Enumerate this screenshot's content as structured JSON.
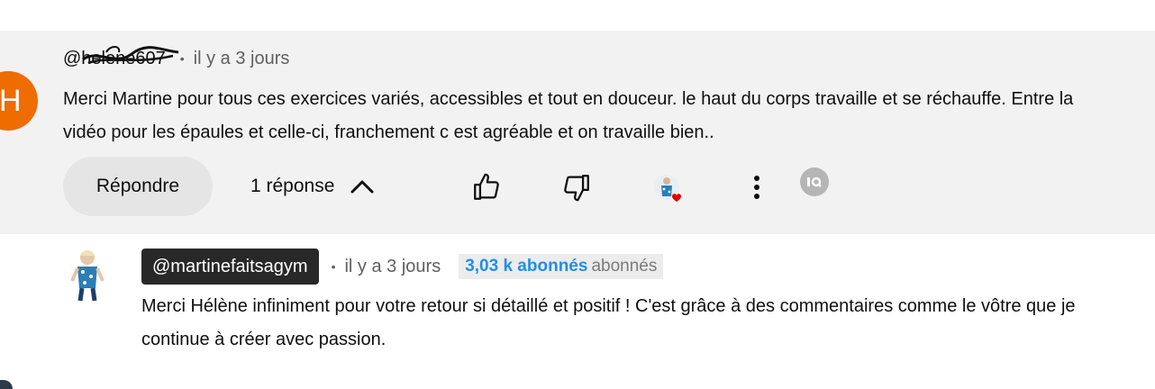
{
  "comment": {
    "avatar_letter": "H",
    "author": "@helene607",
    "separator": "•",
    "time": "il y a 3 jours",
    "text": "Merci Martine pour tous ces exercices variés, accessibles et tout en douceur. le haut du corps travaille et se réchauffe. Entre la vidéo pour les épaules et celle-ci, franchement c est agréable et on travaille bien..",
    "actions": {
      "reply_label": "Répondre",
      "replies_label": "1 réponse",
      "like_icon": "thumb-up-icon",
      "dislike_icon": "thumb-down-icon",
      "creator_heart_icon": "creator-heart-icon",
      "more_icon": "more-vert-icon"
    }
  },
  "reply": {
    "author": "@martinefaitsagym",
    "separator": "•",
    "time": "il y a 3 jours",
    "subscribers_highlight": "3,03 k abonnés",
    "subscribers_suffix": "abonnés",
    "text": "Merci Hélène infiniment pour votre retour si détaillé et positif ! C'est grâce à des commentaires comme le vôtre que je continue à créer avec passion."
  },
  "colors": {
    "avatar_orange": "#ef6c00",
    "comment_bg": "#f2f2f2",
    "button_bg": "#e5e5e5",
    "owner_chip": "#282828",
    "subs_blue": "#1f8fe8",
    "heart_red": "#e00000"
  }
}
